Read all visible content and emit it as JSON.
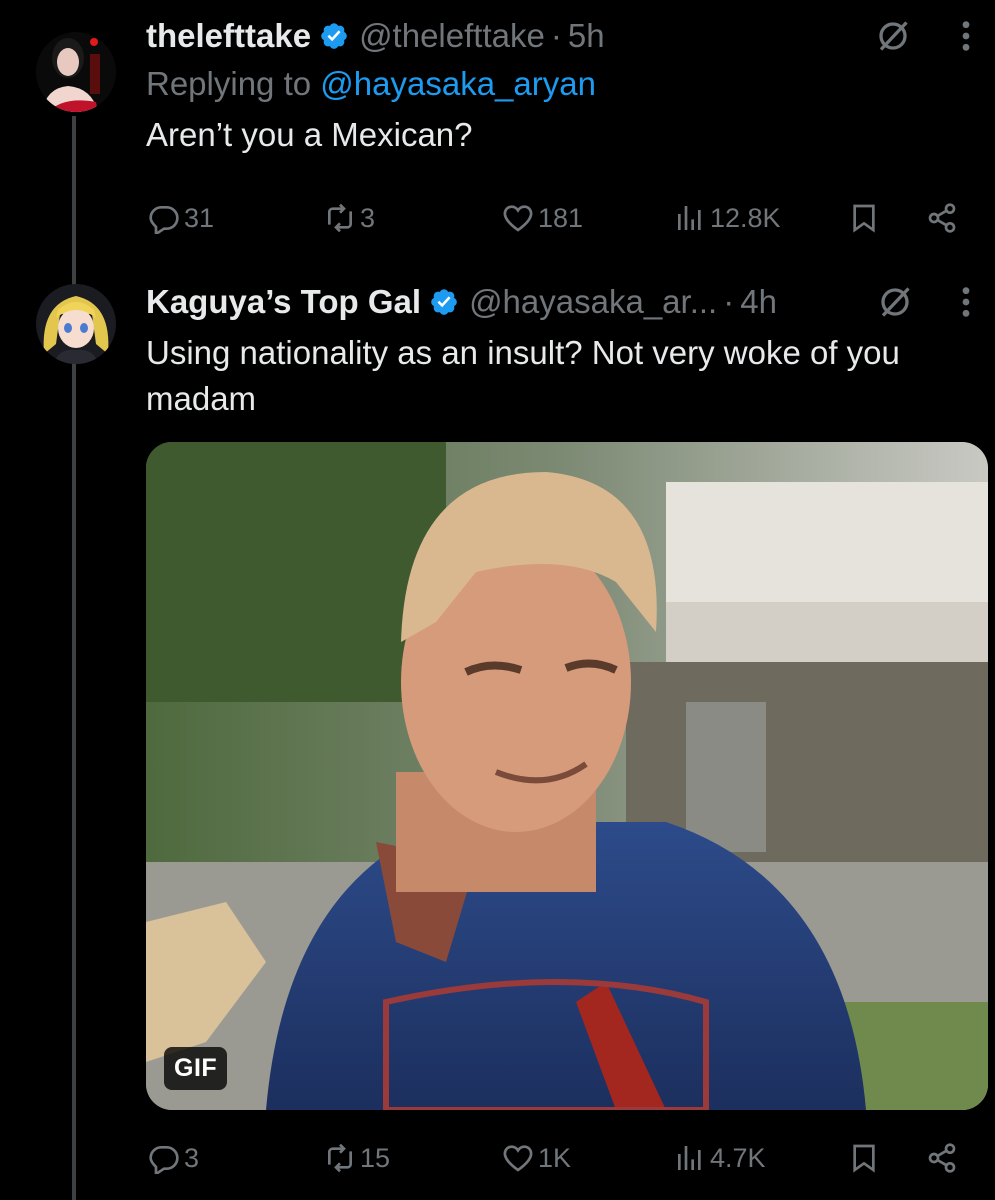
{
  "tweet1": {
    "display_name": "thelefttake",
    "handle": "@thelefttake",
    "separator": "·",
    "time": "5h",
    "replying_prefix": "Replying to",
    "replying_handle": "@hayasaka_aryan",
    "text": "Aren’t you a Mexican?",
    "replies": "31",
    "reposts": "3",
    "likes": "181",
    "views": "12.8K"
  },
  "tweet2": {
    "display_name": "Kaguya’s Top Gal",
    "handle": "@hayasaka_ar...",
    "separator": "·",
    "time": "4h",
    "text": "Using nationality as an insult? Not very woke of you madam",
    "media_badge": "GIF",
    "replies": "3",
    "reposts": "15",
    "likes": "1K",
    "views": "4.7K"
  },
  "colors": {
    "background": "#000000",
    "text": "#e7e9ea",
    "muted": "#71767b",
    "link": "#1d9bf0",
    "verified": "#1d9bf0",
    "thread_line": "#3e4144"
  },
  "icons": {
    "verified": "verified-badge-icon",
    "grok": "grok-icon",
    "more": "more-vertical-icon",
    "reply": "reply-bubble-icon",
    "repost": "repost-icon",
    "like": "heart-icon",
    "views": "views-bars-icon",
    "bookmark": "bookmark-icon",
    "share": "share-icon"
  }
}
